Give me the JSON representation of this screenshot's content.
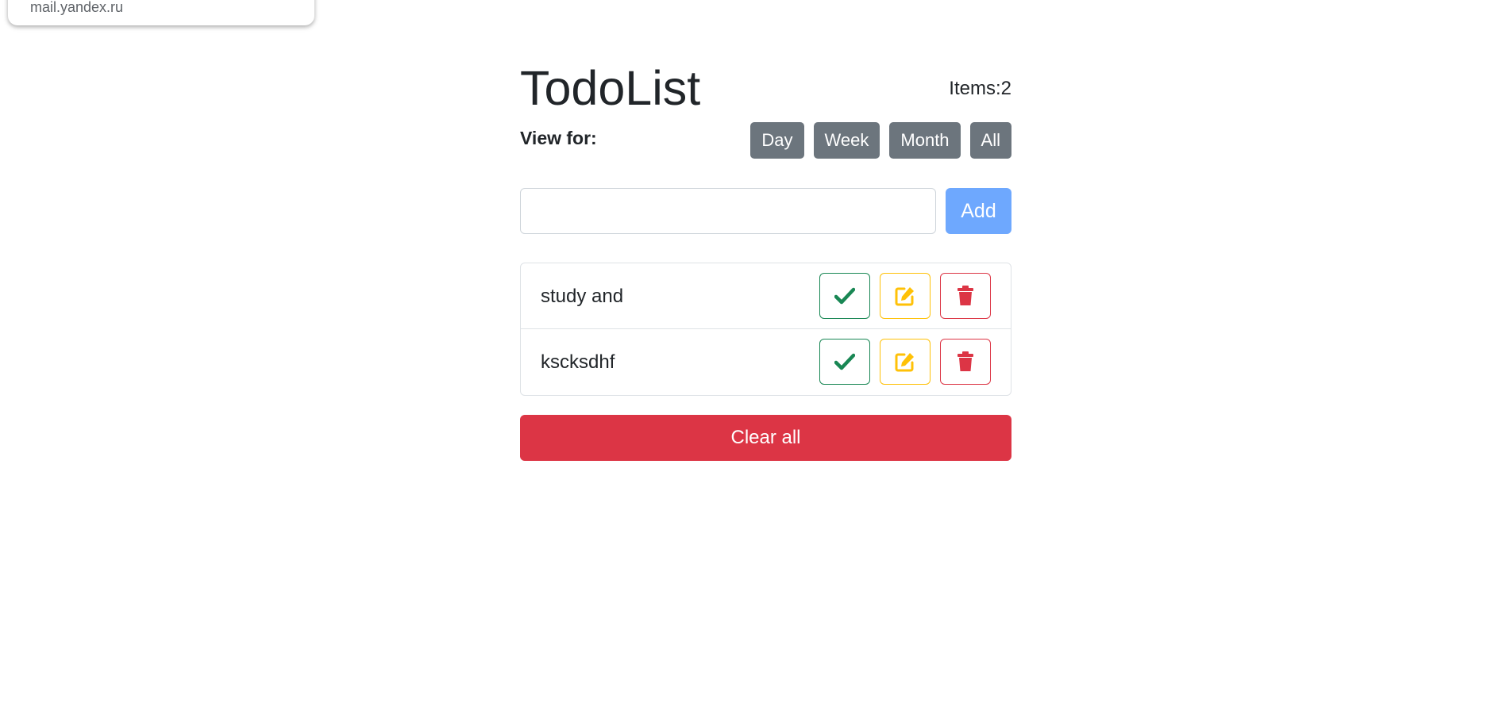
{
  "popup": {
    "text": "mail.yandex.ru"
  },
  "header": {
    "title": "TodoList",
    "count_label": "Items:2"
  },
  "view": {
    "label": "View for:",
    "filters": [
      "Day",
      "Week",
      "Month",
      "All"
    ]
  },
  "add": {
    "input_value": "",
    "button_label": "Add"
  },
  "items": [
    {
      "text": "study and"
    },
    {
      "text": "kscksdhf"
    }
  ],
  "icons": {
    "done": "check-icon",
    "edit": "pencil-square-icon",
    "delete": "trash-icon"
  },
  "colors": {
    "success": "#198754",
    "warning": "#ffc107",
    "danger": "#dc3545",
    "primary_light": "#6ea8fe",
    "secondary": "#6c757d"
  },
  "clear": {
    "label": "Clear all"
  }
}
